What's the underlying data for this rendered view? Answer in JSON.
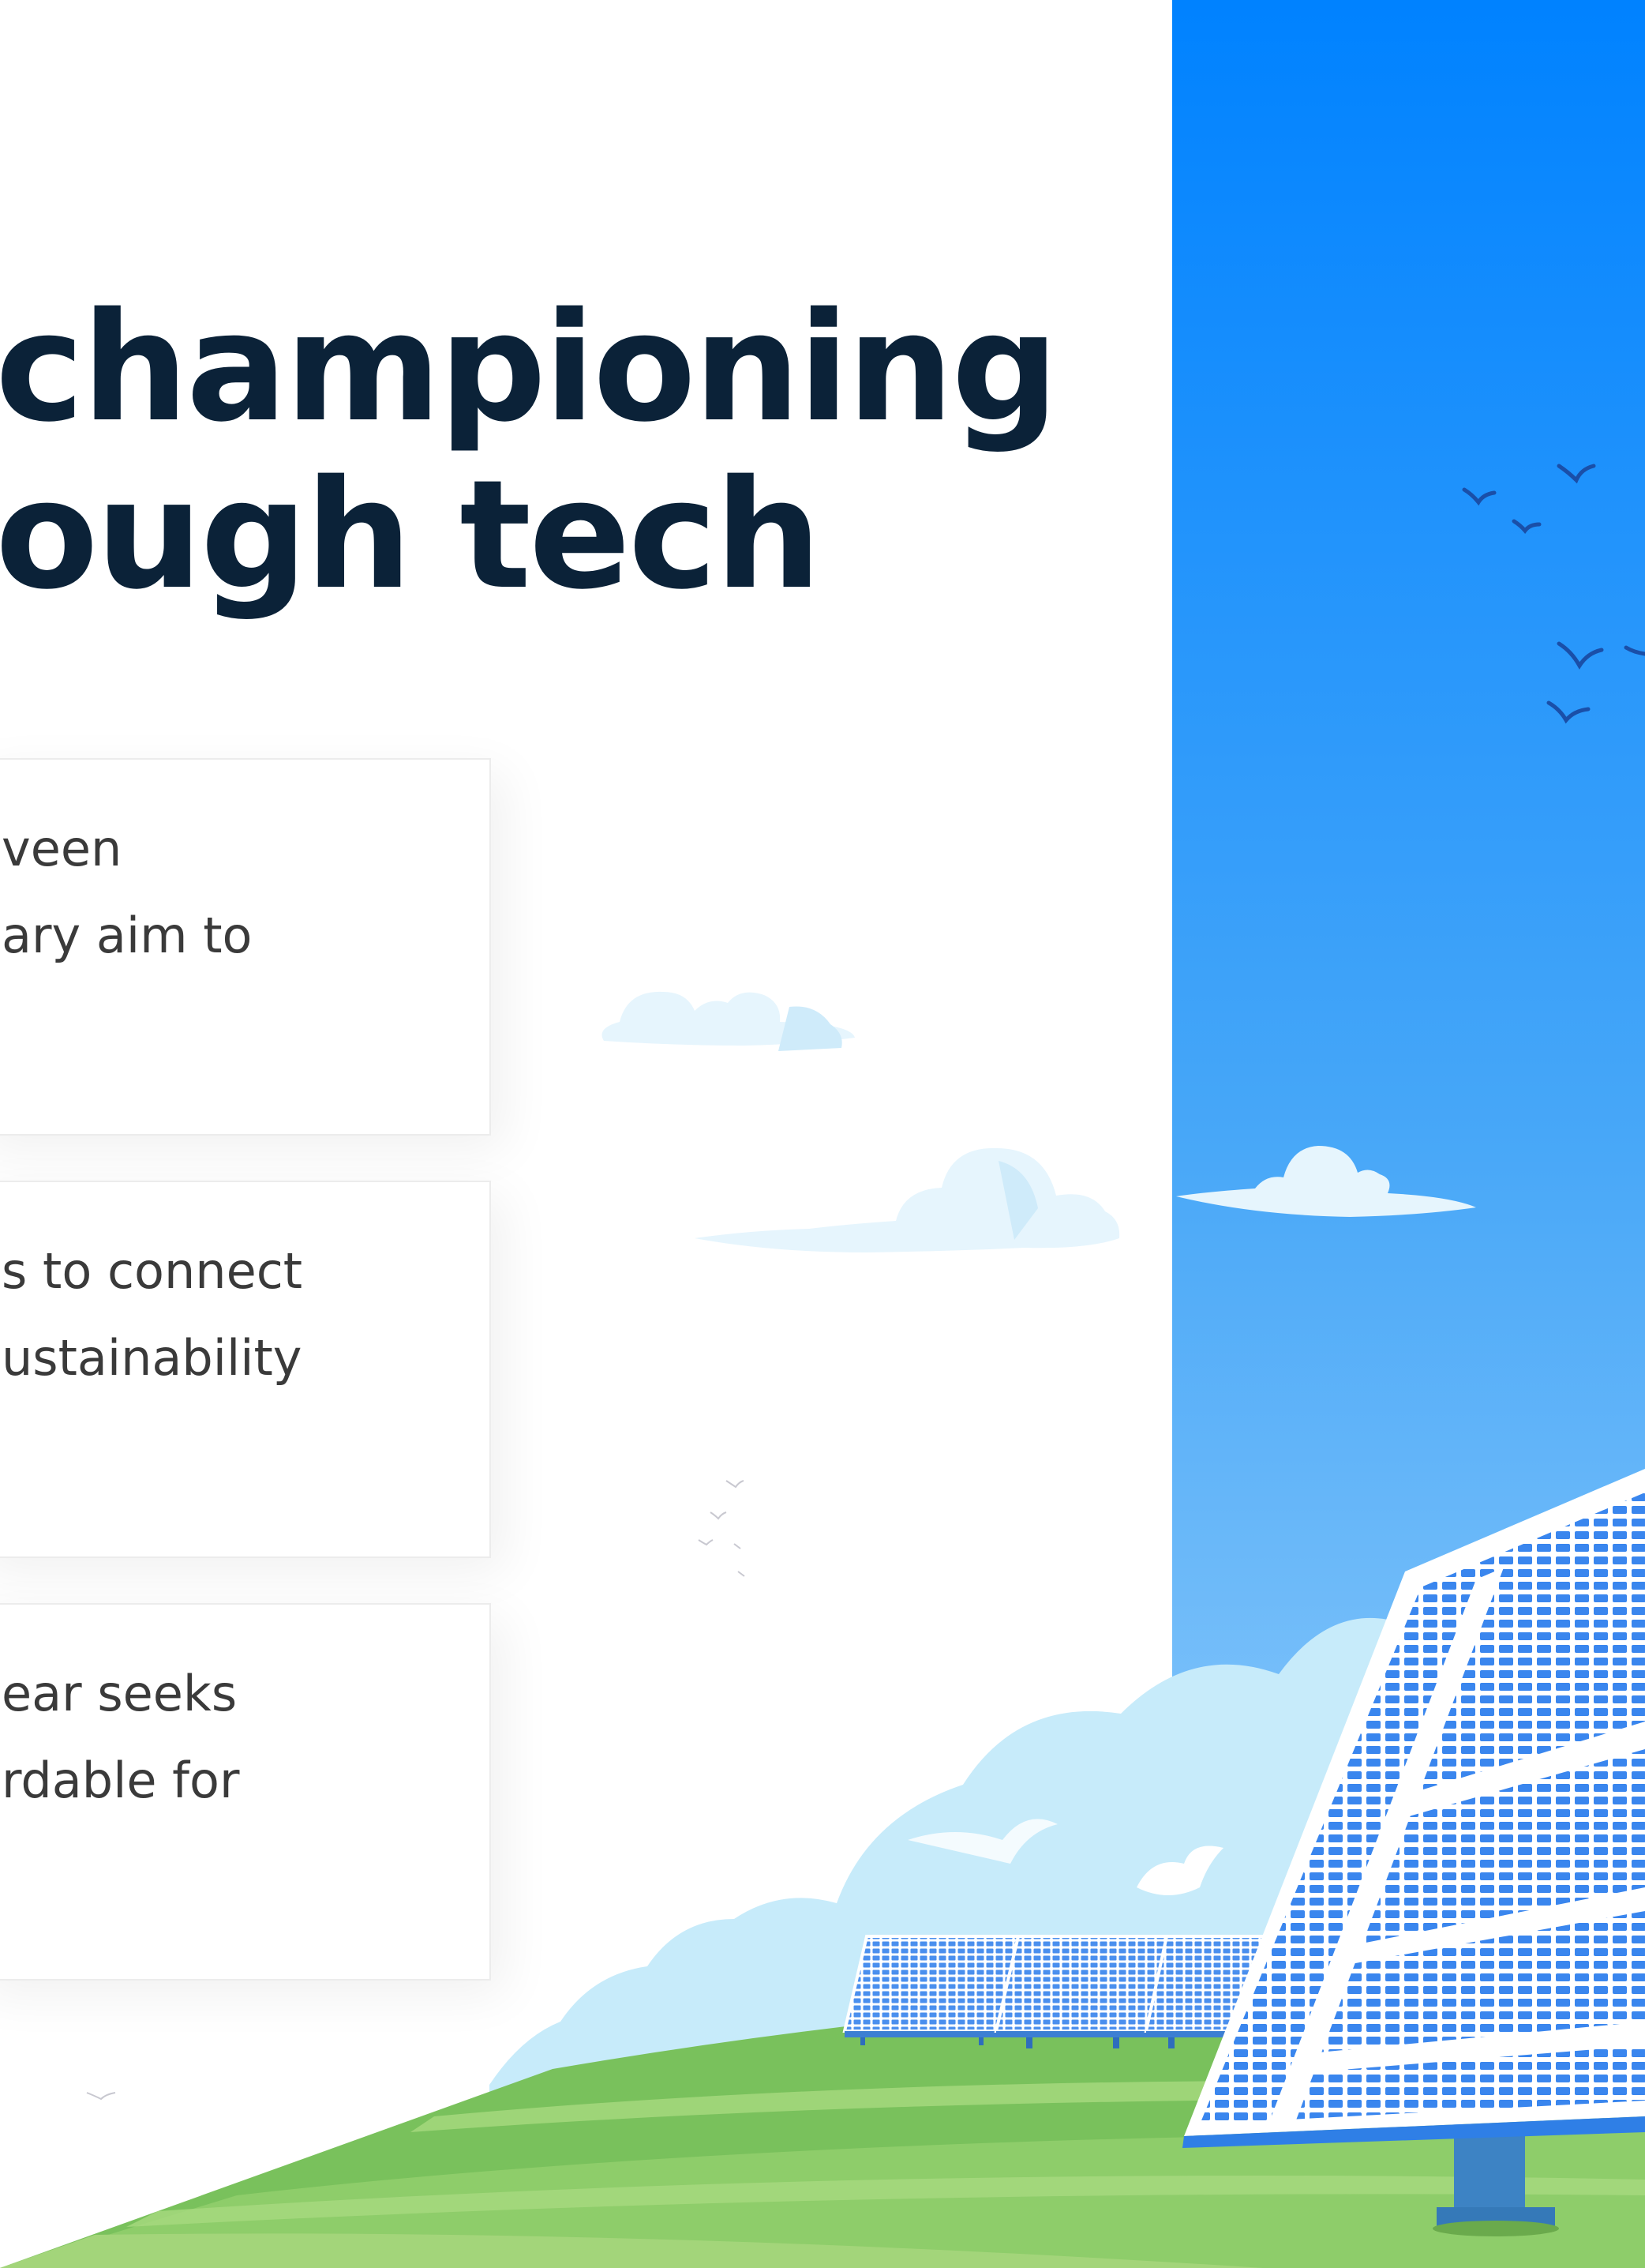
{
  "hero": {
    "headline_line1": "championing",
    "headline_line2": "ough tech"
  },
  "cards": [
    {
      "line1": "veen",
      "line2": "ary aim to"
    },
    {
      "line1": "s to connect",
      "line2": "ustainability"
    },
    {
      "line1": "ear seeks",
      "line2": "rdable for"
    }
  ],
  "colors": {
    "headline": "#0b2238",
    "sky_top": "#0084ff",
    "sky_bottom": "#9fd3fb",
    "grass": "#7cc35f",
    "panel": "#2f7fe6"
  },
  "illustration": {
    "icons": [
      "bird-icon",
      "cloud-icon",
      "solar-panel-icon",
      "grass-hill-icon"
    ]
  }
}
